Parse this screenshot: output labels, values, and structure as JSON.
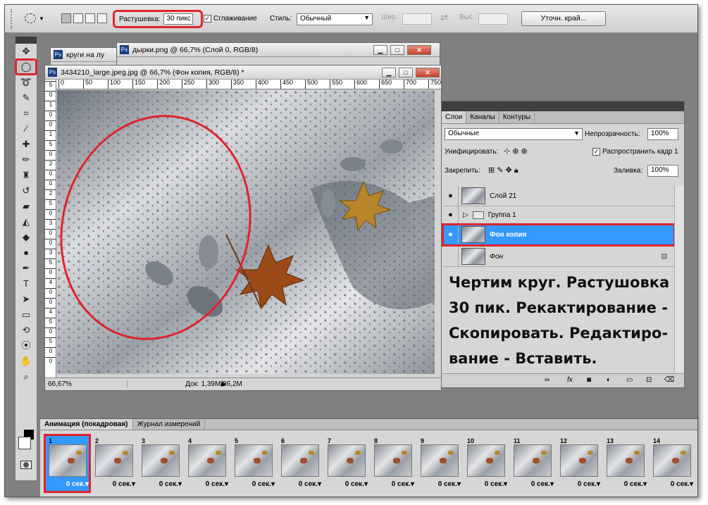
{
  "options_bar": {
    "feather_label": "Растушевка:",
    "feather_value": "30 пикс",
    "antialias_label": "Сглаживание",
    "antialias_checked": "✓",
    "style_label": "Стиль:",
    "style_value": "Обычный",
    "width_label": "Шир.:",
    "height_label": "Выс.:",
    "refine_edge": "Уточн. край...",
    "swap_icon": "⇄"
  },
  "windows": {
    "back1_title": "круги на лу",
    "back2_title": "дырки.png @ 66,7% (Слой 0, RGB/8)",
    "main_title": "3434210_large.jpeg.jpg @ 66,7% (Фон копия, RGB/8) *",
    "ps_badge": "Ps",
    "minimize": "▁",
    "maximize": "□",
    "close": "✕"
  },
  "ruler_h": [
    "0",
    "50",
    "100",
    "150",
    "200",
    "250",
    "300",
    "350",
    "400",
    "450",
    "500",
    "550",
    "600",
    "650",
    "700",
    "750"
  ],
  "ruler_v": [
    "5",
    "0",
    "1",
    "0",
    "0",
    "1",
    "5",
    "0",
    "2",
    "0",
    "0",
    "2",
    "5",
    "0",
    "3",
    "0",
    "0",
    "3",
    "5",
    "0",
    "4",
    "0",
    "0",
    "4",
    "5",
    "0",
    "5",
    "0",
    "0"
  ],
  "status": {
    "zoom": "66,67%",
    "doc": "Док: 1,39M/26,2M",
    "arrow": "▶"
  },
  "layers_panel": {
    "tabs": [
      "Слои",
      "Каналы",
      "Контуры"
    ],
    "blend_mode": "Обычные",
    "opacity_label": "Непрозрачность:",
    "opacity_value": "100%",
    "unify_label": "Унифицировать:",
    "propagate_label": "Распространить кадр 1",
    "lock_label": "Закрепить:",
    "fill_label": "Заливка:",
    "fill_value": "100%",
    "layers": [
      {
        "name": "Слой 21"
      },
      {
        "name": "Группа 1"
      },
      {
        "name": "Фон копия"
      },
      {
        "name": "Фон"
      }
    ],
    "eye": "●",
    "footer_icons": [
      "∞",
      "fx",
      "◙",
      "◐",
      "▭",
      "⊡",
      "⌫"
    ]
  },
  "note": "Чертим круг. Растушовка 30 пик. Рекактирование - Скопировать. Редактиро-вание - Вставить.",
  "animation": {
    "tabs": [
      "Анимация (покадровая)",
      "Журнал измерений"
    ],
    "frames": [
      {
        "num": "1",
        "time": "0 сек."
      },
      {
        "num": "2",
        "time": "0 сек."
      },
      {
        "num": "3",
        "time": "0 сек."
      },
      {
        "num": "4",
        "time": "0 сек."
      },
      {
        "num": "5",
        "time": "0 сек."
      },
      {
        "num": "6",
        "time": "0 сек."
      },
      {
        "num": "7",
        "time": "0 сек."
      },
      {
        "num": "8",
        "time": "0 сек."
      },
      {
        "num": "9",
        "time": "0 сек."
      },
      {
        "num": "10",
        "time": "0 сек."
      },
      {
        "num": "11",
        "time": "0 сек."
      },
      {
        "num": "12",
        "time": "0 сек."
      },
      {
        "num": "13",
        "time": "0 сек."
      },
      {
        "num": "14",
        "time": "0 сек."
      }
    ]
  },
  "tools": [
    {
      "name": "move-tool",
      "glyph": "✥"
    },
    {
      "name": "elliptical-marquee-tool",
      "glyph": "◯"
    },
    {
      "name": "lasso-tool",
      "glyph": "➰"
    },
    {
      "name": "quick-selection-tool",
      "glyph": "✎"
    },
    {
      "name": "crop-tool",
      "glyph": "⌗"
    },
    {
      "name": "eyedropper-tool",
      "glyph": "⁄"
    },
    {
      "name": "healing-brush-tool",
      "glyph": "✚"
    },
    {
      "name": "brush-tool",
      "glyph": "✏"
    },
    {
      "name": "clone-stamp-tool",
      "glyph": "♜"
    },
    {
      "name": "history-brush-tool",
      "glyph": "↺"
    },
    {
      "name": "eraser-tool",
      "glyph": "▰"
    },
    {
      "name": "paint-bucket-tool",
      "glyph": "◭"
    },
    {
      "name": "blur-tool",
      "glyph": "◆"
    },
    {
      "name": "dodge-tool",
      "glyph": "●"
    },
    {
      "name": "pen-tool",
      "glyph": "✒"
    },
    {
      "name": "type-tool",
      "glyph": "T"
    },
    {
      "name": "path-selection-tool",
      "glyph": "➤"
    },
    {
      "name": "shape-tool",
      "glyph": "▭"
    },
    {
      "name": "3d-rotate-tool",
      "glyph": "⟲"
    },
    {
      "name": "3d-orbit-tool",
      "glyph": "⦿"
    },
    {
      "name": "hand-tool",
      "glyph": "✋"
    },
    {
      "name": "zoom-tool",
      "glyph": "⌕"
    }
  ]
}
